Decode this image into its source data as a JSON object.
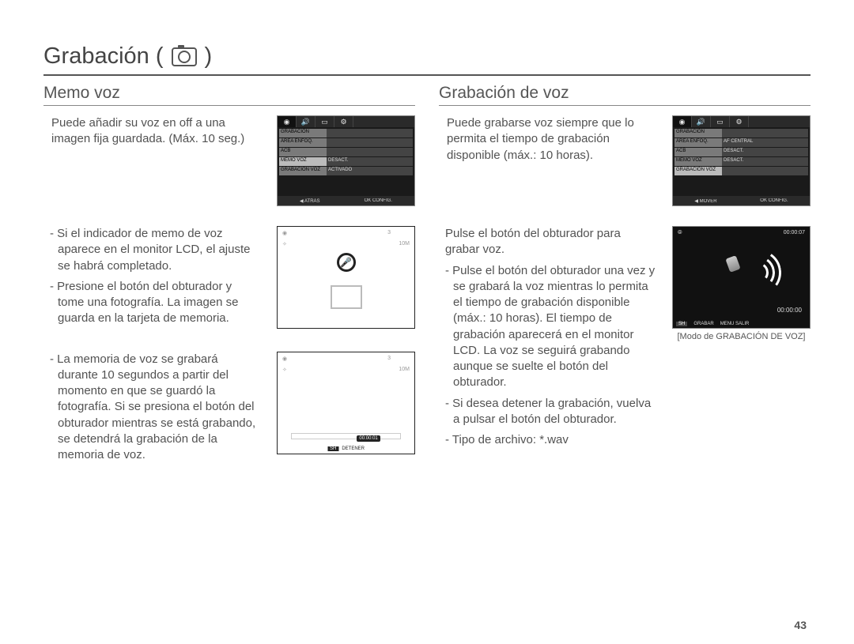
{
  "header": {
    "title": "Grabación ("
  },
  "left": {
    "subhead": "Memo voz",
    "intro": "Puede añadir su voz en off a una imagen ﬁja guardada. (Máx. 10 seg.)",
    "para1": "- Si el indicador de memo de voz aparece en el monitor LCD, el ajuste se habrá completado.",
    "para2": "- Presione el botón del obturador y tome una fotografía. La imagen se guarda en la tarjeta de memoria.",
    "para3": "- La memoria de voz se grabará durante 10 segundos a partir del momento en que se guardó la fotografía. Si se presiona el botón del obturador mientras se está grabando, se detendrá la grabación de la memoria de voz.",
    "lcd_menu": {
      "rows": [
        {
          "k": "GRABACIÓN",
          "v": ""
        },
        {
          "k": "ÁREA ENFOQ.",
          "v": ""
        },
        {
          "k": "ACB",
          "v": ""
        },
        {
          "k": "MEMO VOZ",
          "v": "DESACT.",
          "sel": true
        },
        {
          "k": "GRABACIÓN VOZ",
          "v": "ACTIVADO"
        }
      ],
      "footer_left": "◀ ATRÁS",
      "footer_right": "OK  CONFIG."
    },
    "lcd_photo": {
      "corner3": "3",
      "corner10m": "10M",
      "frame": true
    },
    "lcd_rec": {
      "time": "00:00:01",
      "sh": "SH",
      "stop": "DETENER"
    }
  },
  "right": {
    "subhead": "Grabación de voz",
    "intro": "Puede grabarse voz siempre que lo permita el tiempo de grabación disponible (máx.: 10 horas).",
    "para1": "Pulse el botón del obturador para grabar voz.",
    "para2": "- Pulse el botón del obturador una vez y se grabará la voz mientras lo permita el tiempo de grabación disponible (máx.: 10 horas). El tiempo de grabación aparecerá en el monitor LCD. La voz se seguirá grabando aunque se suelte el botón del obturador.",
    "para3": "- Si desea detener la grabación, vuelva a pulsar el botón del obturador.",
    "para4": "- Tipo de archivo: *.wav",
    "lcd_menu": {
      "rows": [
        {
          "k": "GRABACIÓN",
          "v": ""
        },
        {
          "k": "ÁREA ENFOQ.",
          "v": "AF CENTRAL"
        },
        {
          "k": "ACB",
          "v": "DESACT."
        },
        {
          "k": "MEMO VOZ",
          "v": "DESACT."
        },
        {
          "k": "GRABACIÓN VOZ",
          "v": "",
          "sel": true
        }
      ],
      "footer_left": "◀ MOVER",
      "footer_right": "OK  CONFIG."
    },
    "lcd_voice": {
      "top_time": "00:00:07",
      "time": "00:00:00",
      "sh": "SH",
      "rec": "GRABAR",
      "exit": "MENU SALIR"
    },
    "caption": "[Modo de GRABACIÓN DE VOZ]"
  },
  "page_number": "43"
}
